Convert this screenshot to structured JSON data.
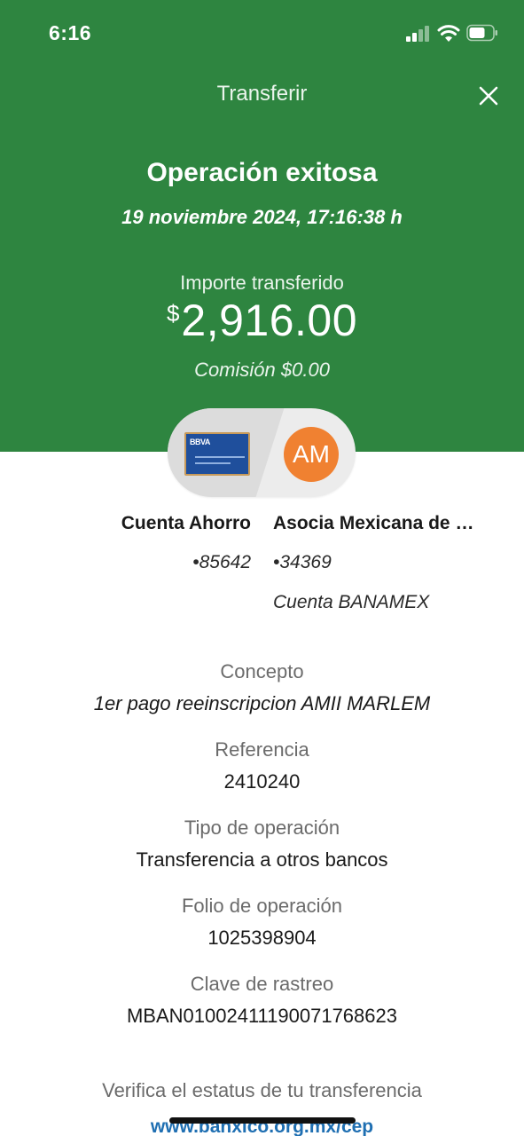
{
  "status_bar": {
    "time": "6:16"
  },
  "nav": {
    "title": "Transferir"
  },
  "operation": {
    "title": "Operación exitosa",
    "date": "19 noviembre 2024, 17:16:38 h"
  },
  "amount": {
    "label": "Importe transferido",
    "currency_symbol": "$",
    "value": "2,916.00",
    "commission": "Comisión  $0.00"
  },
  "transfer_visual": {
    "card_logo": "BBVA",
    "avatar_initials": "AM",
    "avatar_color": "#f08131"
  },
  "from_account": {
    "name": "Cuenta Ahorro",
    "number": "•85642"
  },
  "to_account": {
    "name": "Asocia Mexicana de Ingenieros Industriales",
    "number": "•34369",
    "bank": "Cuenta BANAMEX"
  },
  "details": [
    {
      "label": "Concepto",
      "value": "1er pago reeinscripcion AMII MARLEM"
    },
    {
      "label": "Referencia",
      "value": "2410240"
    },
    {
      "label": "Tipo de operación",
      "value": "Transferencia a otros bancos"
    },
    {
      "label": "Folio de operación",
      "value": "1025398904"
    },
    {
      "label": "Clave de rastreo",
      "value": "MBAN01002411190071768623"
    }
  ],
  "verify": {
    "text": "Verifica el estatus de tu transferencia",
    "link": "www.banxico.org.mx/cep"
  },
  "colors": {
    "header_green": "#2e8540",
    "link_blue": "#1f6fb2"
  }
}
